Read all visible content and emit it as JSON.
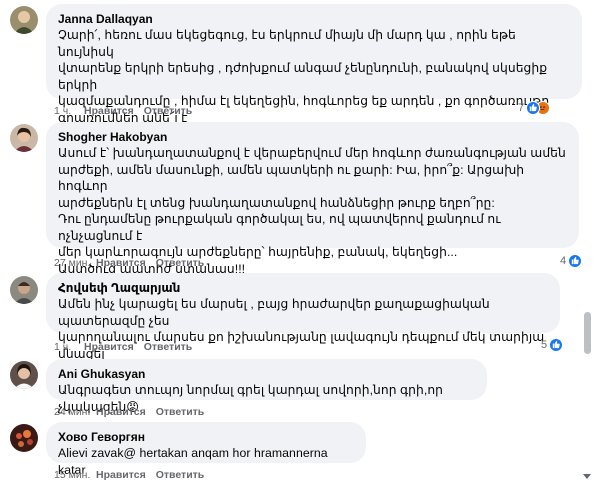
{
  "comments": [
    {
      "name": "Janna Dallaqyan",
      "text": "Չարի՛, հեռու մաս եկեցեգուց, էս երկրում միայն մի մարդ կա , որին եթե նույնիսկ\nվտարենք երկրի երեսից , դժոխքում անգամ չենընդունի, բանակով սկսեցիք երկրի\nկազմաքանդումը , հիմա էլ եկեղեցին, հոգևորեց եք արդեն , քո գործառույթը\nգրառումներ անե՜լ է",
      "time": "1 ч.",
      "like": "Нравится",
      "reply": "Ответить",
      "reactions": "7"
    },
    {
      "name": "Shogher Hakobyan",
      "text": "Ասում է՝ խանդաղատանքով է վերաբերվում մեր հոգևոր ժառանգության ամեն\nարժեքի, ամեն մասունքի, ամեն պատկերի ու քարի: Իա, իրո՞ք: Արցախի հոգևոր\nարժեքներն էլ տենց խանդաղատանքով հանձնեցիր թուրք եղբո՞րը:\nԴու ընդամենը թուրքական գործակալ ես, ով պատվերով քանդում ու ոչնչացնում է\nմեր կարևորագույն արժեքները՝ հայրենիք, բանակ, եկեղեցի...\nԱստծուց պատիժ ստանաս!!!",
      "time": "27 мин.",
      "like": "Нравится",
      "reply": "Ответить",
      "reactions": "4"
    },
    {
      "name": "Հովսեփ Ղազարյան",
      "text": "Ամեն ինչ կարացել ես մարսել , բայց հրաժարվեր քաղաքացիական պատերազմը չես\nկարողանալու մարսես քո իշխանությանը լավագույն դեպքում մեկ տարիյա մնացել",
      "time": "1 ч.",
      "like": "Нравится",
      "reply": "Ответить",
      "reactions": "5"
    },
    {
      "name": "Ani Ghukasyan",
      "text": "Անգրագետ տուպոյ նորմալ գրել կարդալ սովորի,նոր գրի,որ չկակազեն😡",
      "time": "24 мин.",
      "like": "Нравится",
      "reply": "Ответить",
      "reactions": ""
    },
    {
      "name": "Хово Геворгян",
      "text": "Alievi zavak@ hertakan anqam hor hramannerna katar",
      "time": "15 мин.",
      "like": "Нравится",
      "reply": "Ответить",
      "reactions": ""
    }
  ],
  "colors": {
    "bubble": "#f0f2f5",
    "like_reaction": "#1877f2",
    "angry_reaction": "#e9710f",
    "meta_text": "#65676b"
  }
}
